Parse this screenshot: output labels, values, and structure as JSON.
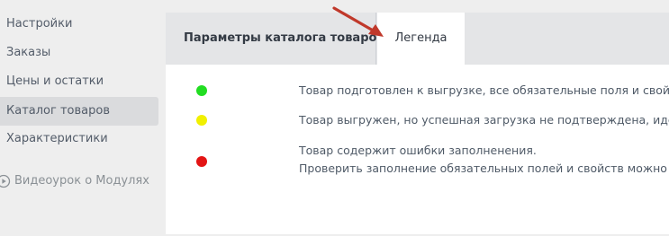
{
  "sidebar": {
    "items": [
      {
        "label": "Настройки"
      },
      {
        "label": "Заказы"
      },
      {
        "label": "Цены и остатки"
      },
      {
        "label": "Каталог товаров",
        "active": true
      },
      {
        "label": "Характеристики"
      }
    ],
    "video_link": {
      "label": "Видеоурок о Модулях",
      "icon": "play-circle-icon"
    }
  },
  "tabs": {
    "catalog_params": {
      "label": "Параметры каталога товаров"
    },
    "legend": {
      "label": "Легенда",
      "active": true
    }
  },
  "legend": {
    "rows": [
      {
        "status_color": "#22dd22",
        "lines": [
          "Товар подготовлен к выгрузке, все обязательные поля и свойств"
        ]
      },
      {
        "status_color": "#f1f000",
        "lines": [
          "Товар выгружен, но успешная загрузка не подтверждена, идет пр"
        ]
      },
      {
        "status_color": "#e31414",
        "lines": [
          "Товар содержит ошибки заполненения.",
          "Проверить заполнение обязательных полей и свойств можно на"
        ]
      }
    ]
  },
  "annotation": {
    "color": "#c0392b",
    "icon": "red-arrow-icon"
  },
  "colors": {
    "background": "#eeeeee",
    "active_sidebar": "#dadbdd",
    "tab_bar": "#e4e5e7",
    "panel": "#ffffff"
  }
}
